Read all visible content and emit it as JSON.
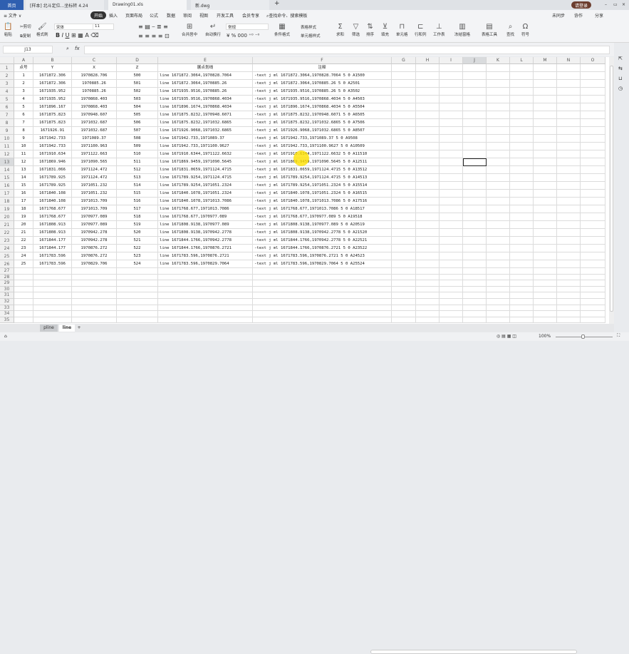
{
  "titlebar": {
    "home": "首页",
    "tabs": [
      "[样本] 北斗定位...坐标转 4.24",
      "Drawing01.xls",
      "新.dwg"
    ],
    "new_tab": "+",
    "user": "请登录"
  },
  "menubar": {
    "file": "≡ 文件 ∨",
    "items": [
      "开始",
      "插入",
      "页面布局",
      "公式",
      "数据",
      "审阅",
      "视图",
      "开发工具",
      "会员专享"
    ],
    "search": "查找命令、搜索模板",
    "sync": "未同步",
    "collab": "协作",
    "share": "分享"
  },
  "ribbon": {
    "paste": "粘贴",
    "cut": "剪切",
    "copy": "复制",
    "format_painter": "格式刷",
    "font": "宋体",
    "size": "11",
    "merge": "合并居中",
    "wrap": "自动换行",
    "number_format": "常规",
    "cond_format": "条件格式",
    "table_style": "表格样式",
    "cell_style": "单元格样式",
    "sum": "求和",
    "filter": "筛选",
    "sort": "排序",
    "fill": "填充",
    "cell": "单元格",
    "rowcol": "行和列",
    "sheet": "工作表",
    "freeze": "冻结窗格",
    "tools": "表格工具",
    "find": "查找",
    "symbol": "符号"
  },
  "formula": {
    "name_box": "J13",
    "fx": "fx",
    "value": ""
  },
  "columns": [
    "A",
    "B",
    "C",
    "D",
    "E",
    "F",
    "G",
    "H",
    "I",
    "J",
    "K",
    "L",
    "M",
    "N",
    "O"
  ],
  "header_row": [
    "点号",
    "Y",
    "X",
    "Z",
    "展点划线",
    "注释"
  ],
  "rows": [
    [
      "1",
      "1671872.306",
      "1970828.706",
      "500",
      "line 1671872.3064,1970828.7064",
      "-text j ml 1671872.3064,1970828.7064 5 0 A1500"
    ],
    [
      "2",
      "1671872.306",
      "1970885.26",
      "501",
      "line 1671872.3064,1970885.26",
      "-text j ml 1671872.3064,1970885.26 5 0 A2501"
    ],
    [
      "3",
      "1671935.952",
      "1970885.26",
      "502",
      "line 1671935.9516,1970885.26",
      "-text j ml 1671935.9516,1970885.26 5 0 A3502"
    ],
    [
      "4",
      "1671935.952",
      "1970868.403",
      "503",
      "line 1671935.9516,1970868.4034",
      "-text j ml 1671935.9516,1970868.4034 5 0 A4503"
    ],
    [
      "5",
      "1671896.167",
      "1970868.403",
      "504",
      "line 1671896.1674,1970868.4034",
      "-text j ml 1671896.1674,1970868.4034 5 0 A5504"
    ],
    [
      "6",
      "1671875.823",
      "1970948.607",
      "505",
      "line 1671875.8232,1970948.6071",
      "-text j ml 1671875.8232,1970948.6071 5 0 A6505"
    ],
    [
      "7",
      "1671875.823",
      "1971032.687",
      "506",
      "line 1671875.8232,1971032.6865",
      "-text j ml 1671875.8232,1971032.6865 5 0 A7506"
    ],
    [
      "8",
      "1671926.91",
      "1971032.687",
      "507",
      "line 1671926.9068,1971032.6865",
      "-text j ml 1671926.9068,1971032.6865 5 0 A8507"
    ],
    [
      "9",
      "1671942.733",
      "1971089.37",
      "508",
      "line 1671942.733,1971089.37",
      "-text j ml 1671942.733,1971089.37 5 0 A9508"
    ],
    [
      "10",
      "1671942.733",
      "1971100.963",
      "509",
      "line 1671942.733,1971100.9627",
      "-text j ml 1671942.733,1971100.9627 5 0 A10509"
    ],
    [
      "11",
      "1671910.634",
      "1971122.663",
      "510",
      "line 1671910.6344,1971122.6632",
      "-text j ml 1671910.6344,1971122.6632 5 0 A11510"
    ],
    [
      "12",
      "1671869.946",
      "1971090.565",
      "511",
      "line 1671869.9459,1971090.5645",
      "-text j ml 1671869.9459,1971090.5645 5 0 A12511"
    ],
    [
      "13",
      "1671831.066",
      "1971124.472",
      "512",
      "line 1671831.0659,1971124.4715",
      "-text j ml 1671831.0659,1971124.4715 5 0 A13512"
    ],
    [
      "14",
      "1671789.925",
      "1971124.472",
      "513",
      "line 1671789.9254,1971124.4715",
      "-text j ml 1671789.9254,1971124.4715 5 0 A14513"
    ],
    [
      "15",
      "1671789.925",
      "1971051.232",
      "514",
      "line 1671789.9254,1971051.2324",
      "-text j ml 1671789.9254,1971051.2324 5 0 A15514"
    ],
    [
      "16",
      "1671840.108",
      "1971051.232",
      "515",
      "line 1671840.1078,1971051.2324",
      "-text j ml 1671840.1078,1971051.2324 5 0 A16515"
    ],
    [
      "17",
      "1671840.108",
      "1971013.709",
      "516",
      "line 1671840.1078,1971013.7086",
      "-text j ml 1671840.1078,1971013.7086 5 0 A17516"
    ],
    [
      "18",
      "1671768.677",
      "1971013.709",
      "517",
      "line 1671768.677,1971013.7086",
      "-text j ml 1671768.677,1971013.7086 5 0 A18517"
    ],
    [
      "19",
      "1671768.677",
      "1970977.089",
      "518",
      "line 1671768.677,1970977.089",
      "-text j ml 1671768.677,1970977.089 5 0 A19518"
    ],
    [
      "20",
      "1671808.913",
      "1970977.089",
      "519",
      "line 1671808.9138,1970977.089",
      "-text j ml 1671808.9138,1970977.089 5 0 A20519"
    ],
    [
      "21",
      "1671808.913",
      "1970942.278",
      "520",
      "line 1671808.9138,1970942.2778",
      "-text j ml 1671808.9138,1970942.2778 5 0 A21520"
    ],
    [
      "22",
      "1671844.177",
      "1970942.278",
      "521",
      "line 1671844.1766,1970942.2778",
      "-text j ml 1671844.1766,1970942.2778 5 0 A22521"
    ],
    [
      "23",
      "1671844.177",
      "1970876.272",
      "522",
      "line 1671844.1766,1970876.2721",
      "-text j ml 1671844.1766,1970876.2721 5 0 A23522"
    ],
    [
      "24",
      "1671783.596",
      "1970876.272",
      "523",
      "line 1671783.596,1970876.2721",
      "-text j ml 1671783.596,1970876.2721 5 0 A24523"
    ],
    [
      "25",
      "1671783.596",
      "1970829.706",
      "524",
      "line 1671783.596,1970829.7064",
      "-text j ml 1671783.596,1970829.7064 5 0 A25524"
    ]
  ],
  "sheets": [
    "pline",
    "line"
  ],
  "active_sheet": "line",
  "add_sheet": "+",
  "status": {
    "zoom": "100%"
  }
}
